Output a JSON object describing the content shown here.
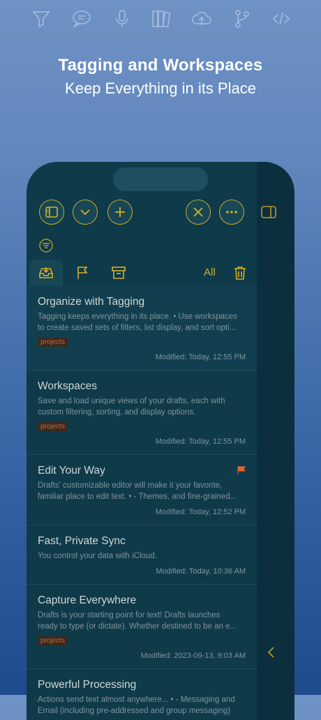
{
  "top_icons": [
    "filter-icon",
    "speech-bubble-icon",
    "microphone-icon",
    "books-icon",
    "cloud-upload-icon",
    "branch-icon",
    "code-icon"
  ],
  "hero": {
    "title": "Tagging and Workspaces",
    "subtitle": "Keep Everything in its Place"
  },
  "toolbar": {
    "sidebar": "sidebar-icon",
    "expand": "chevron-down-icon",
    "add": "plus-icon",
    "close": "close-icon",
    "more": "ellipsis-icon"
  },
  "tabs": {
    "all_label": "All"
  },
  "colors": {
    "accent": "#d6b02b",
    "background": "#0f3a4a",
    "tag": "#c06a3c",
    "flag": "#e0662a"
  },
  "drafts": [
    {
      "title": "Organize with Tagging",
      "body_line1": "Tagging keeps everything in its place. • Use workspaces",
      "body_line2": "to create saved sets of filters, list display, and sort opti...",
      "tag": "projects",
      "modified": "Modified: Today, 12:55 PM",
      "flagged": false
    },
    {
      "title": "Workspaces",
      "body_line1": "Save and load unique views of your drafts, each with",
      "body_line2": "custom filtering, sorting, and display options.",
      "tag": "projects",
      "modified": "Modified: Today, 12:55 PM",
      "flagged": false
    },
    {
      "title": "Edit Your Way",
      "body_line1": "Drafts' customizable editor will make it your favorite,",
      "body_line2": "familiar place to edit text. • - Themes, and fine-grained...",
      "tag": "",
      "modified": "Modified: Today, 12:52 PM",
      "flagged": true
    },
    {
      "title": "Fast, Private Sync",
      "body_line1": "You control your data with iCloud.",
      "body_line2": "",
      "tag": "",
      "modified": "Modified: Today, 10:36 AM",
      "flagged": false
    },
    {
      "title": "Capture Everywhere",
      "body_line1": "Drafts is your starting point for text! Drafts launches",
      "body_line2": "ready to type (or dictate). Whether destined to be an e...",
      "tag": "projects",
      "modified": "Modified: 2023-09-13, 9:03 AM",
      "flagged": false
    },
    {
      "title": "Powerful Processing",
      "body_line1": "Actions send text almost anywhere... • - Messaging and",
      "body_line2": "Email (including pre-addressed and group messaging)",
      "tag": "",
      "modified": "",
      "flagged": false
    }
  ]
}
